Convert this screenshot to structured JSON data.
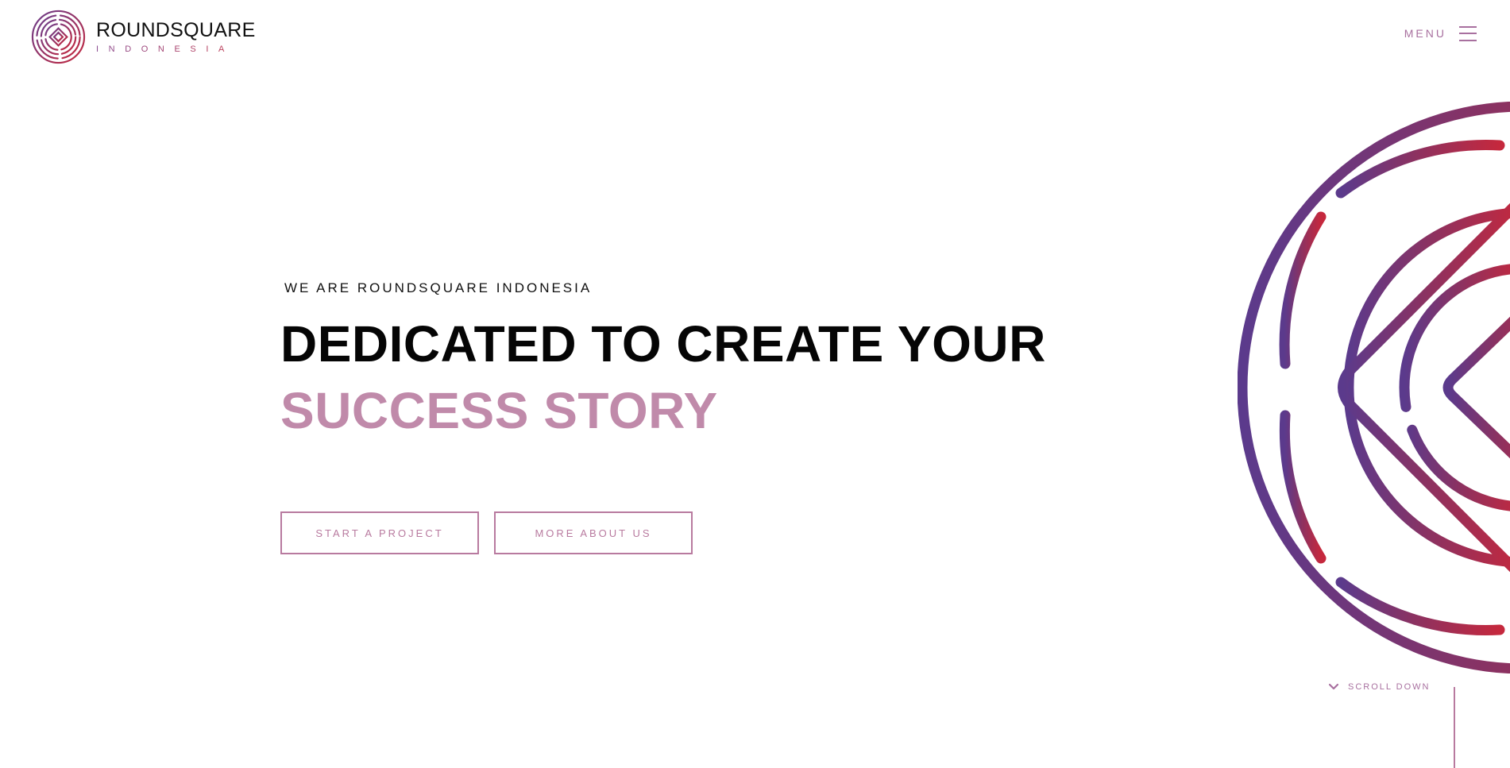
{
  "header": {
    "logo": {
      "name": "ROUNDSQUARE",
      "subtitle": "INDONESIA",
      "icon": "labyrinth-roundel-icon"
    },
    "menu": {
      "label": "MENU",
      "icon": "hamburger-icon"
    }
  },
  "hero": {
    "eyebrow": "WE ARE ROUNDSQUARE INDONESIA",
    "headline_line1": "DEDICATED TO CREATE YOUR",
    "headline_line2": "SUCCESS STORY",
    "buttons": {
      "start_project": "START A PROJECT",
      "more_about": "MORE ABOUT US"
    }
  },
  "decoration": {
    "icon": "labyrinth-emblem-icon"
  },
  "scroll": {
    "label": "SCROLL DOWN",
    "icon": "chevron-down-icon"
  },
  "colors": {
    "accent": "#b87a9f",
    "headline_secondary": "#c08aaa",
    "gradient_start": "#5b3a8c",
    "gradient_end": "#c5283d",
    "text_dark": "#050505"
  }
}
